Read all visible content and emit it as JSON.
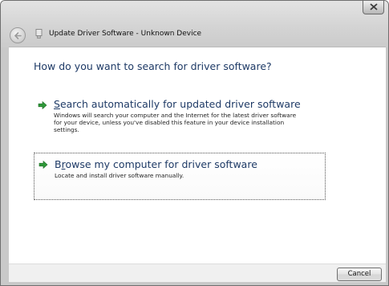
{
  "window": {
    "title": "Update Driver Software - Unknown Device",
    "close_icon": "close-icon",
    "back_icon": "back-arrow-icon",
    "device_icon": "device-icon"
  },
  "main": {
    "heading": "How do you want to search for driver software?",
    "options": [
      {
        "accelerator": "S",
        "title_rest": "earch automatically for updated driver software",
        "description": "Windows will search your computer and the Internet for the latest driver software\nfor your device, unless you've disabled this feature in your device installation\nsettings.",
        "icon": "green-arrow-icon"
      },
      {
        "title_first": "B",
        "accelerator": "r",
        "title_rest": "owse my computer for driver software",
        "description": "Locate and install driver software manually.",
        "icon": "green-arrow-icon"
      }
    ]
  },
  "footer": {
    "cancel_label": "Cancel"
  },
  "colors": {
    "heading": "#1e3a66",
    "arrow": "#2f9a3a"
  }
}
